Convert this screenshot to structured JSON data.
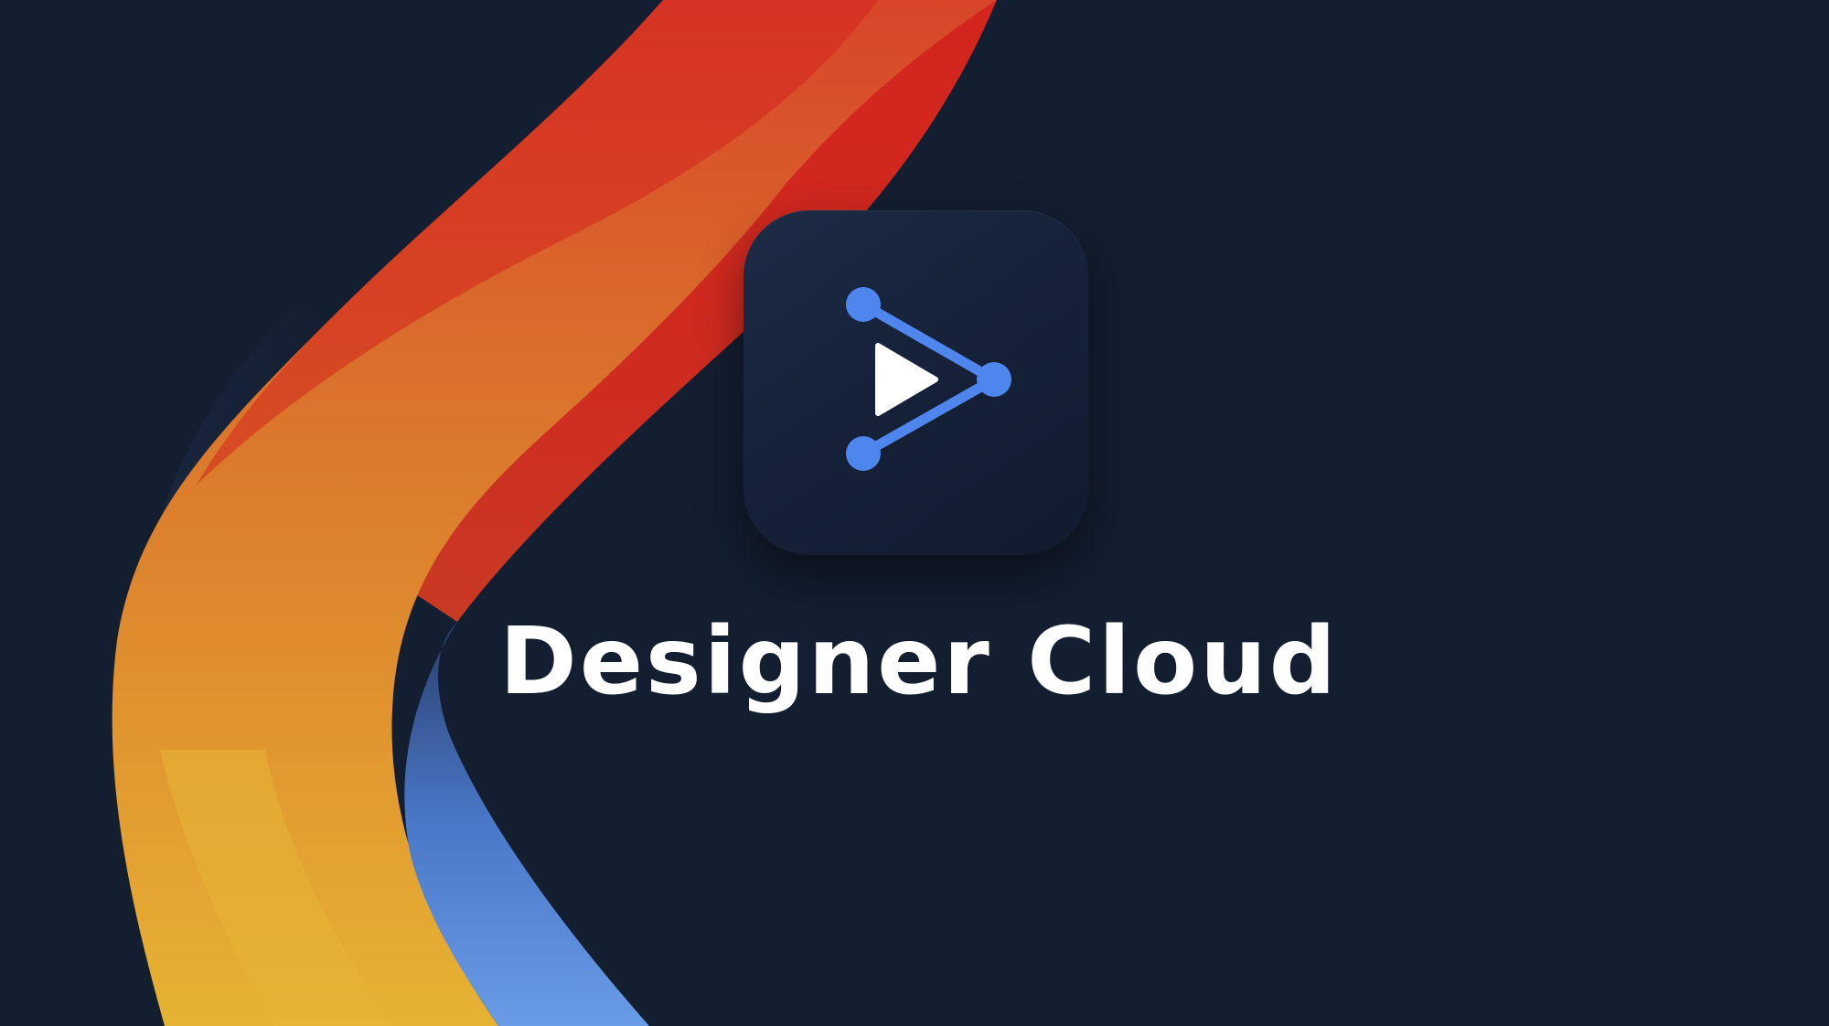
{
  "app": {
    "title": "Designer Cloud",
    "icon": "play-network-icon"
  },
  "colors": {
    "background": "#131e30",
    "ribbon_red": "#d3241d",
    "ribbon_orange": "#e07a2c",
    "ribbon_yellow": "#e6b333",
    "ribbon_blue": "#5a8ee0",
    "icon_accent": "#4f86ee",
    "text": "#ffffff"
  }
}
